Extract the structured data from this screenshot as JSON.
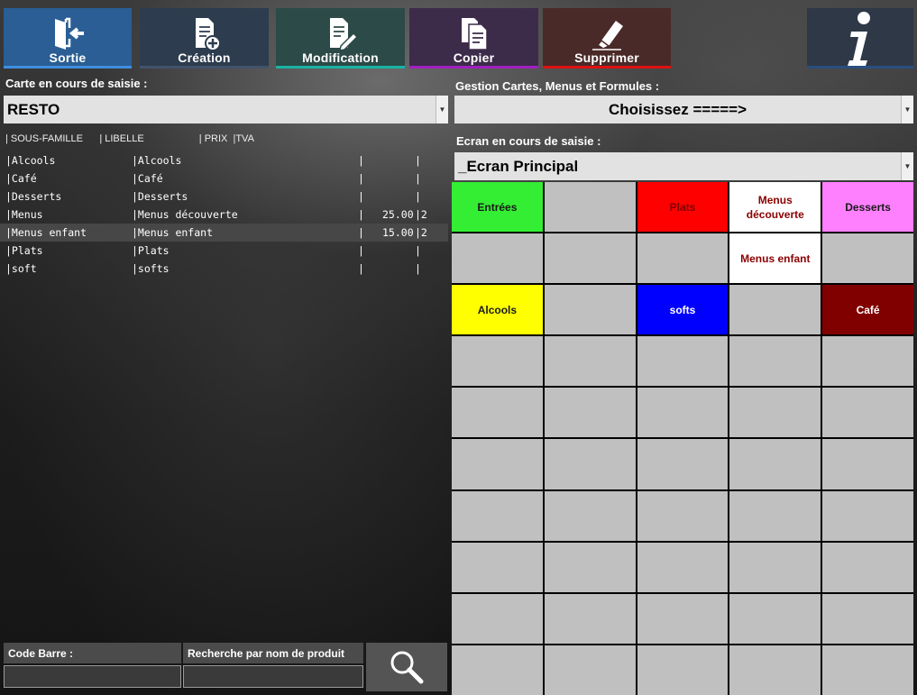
{
  "toolbar": {
    "sortie": "Sortie",
    "creation": "Création",
    "modification": "Modification",
    "copier": "Copier",
    "supprimer": "Supprimer"
  },
  "colors": {
    "sortie": "#2a5e94",
    "creation": "#2d3c4e",
    "modification": "#2c4a47",
    "copier": "#3d2b4a",
    "supprimer": "#4a2a28",
    "info": "#2f3846"
  },
  "left": {
    "carte_label": "Carte en cours de saisie :",
    "carte_value": "RESTO",
    "list_header": "| SOUS-FAMILLE      | LIBELLE                    | PRIX  |TVA",
    "rows": [
      {
        "sf": "|Alcools",
        "lib": "|Alcools",
        "sep": "|",
        "prix": "",
        "tva": "|"
      },
      {
        "sf": "|Café",
        "lib": "|Café",
        "sep": "|",
        "prix": "",
        "tva": "|"
      },
      {
        "sf": "|Desserts",
        "lib": "|Desserts",
        "sep": "|",
        "prix": "",
        "tva": "|"
      },
      {
        "sf": "|Menus",
        "lib": "|Menus découverte",
        "sep": "|",
        "prix": "25.00",
        "tva": "|2"
      },
      {
        "sf": "|Menus enfant",
        "lib": "|Menus enfant",
        "sep": "|",
        "prix": "15.00",
        "tva": "|2"
      },
      {
        "sf": "|Plats",
        "lib": "|Plats",
        "sep": "|",
        "prix": "",
        "tva": "|"
      },
      {
        "sf": "|soft",
        "lib": "|softs",
        "sep": "|",
        "prix": "",
        "tva": "|"
      }
    ],
    "selected_row_index": 4
  },
  "right": {
    "gestion_label": "Gestion Cartes, Menus et Formules  :",
    "gestion_value": "Choisissez  =====>",
    "ecran_label": "Ecran en cours de saisie :",
    "ecran_value": "_Ecran Principal"
  },
  "grid": {
    "buttons": [
      {
        "label": "Entrées",
        "bg": "#33ee33",
        "fg": "#1a1a1a"
      },
      {
        "label": "",
        "bg": "#c0c0c0",
        "fg": "#000"
      },
      {
        "label": "Plats",
        "bg": "#ff0000",
        "fg": "#7a0000"
      },
      {
        "label": "Menus\ndécouverte",
        "bg": "#ffffff",
        "fg": "#8b0000"
      },
      {
        "label": "Desserts",
        "bg": "#ff80ff",
        "fg": "#1a1a1a"
      },
      {
        "label": "",
        "bg": "#c0c0c0",
        "fg": "#000"
      },
      {
        "label": "",
        "bg": "#c0c0c0",
        "fg": "#000"
      },
      {
        "label": "",
        "bg": "#c0c0c0",
        "fg": "#000"
      },
      {
        "label": "Menus enfant",
        "bg": "#ffffff",
        "fg": "#8b0000"
      },
      {
        "label": "",
        "bg": "#c0c0c0",
        "fg": "#000"
      },
      {
        "label": "Alcools",
        "bg": "#ffff00",
        "fg": "#1a1a1a"
      },
      {
        "label": "",
        "bg": "#c0c0c0",
        "fg": "#000"
      },
      {
        "label": "softs",
        "bg": "#0000ff",
        "fg": "#ffffff"
      },
      {
        "label": "",
        "bg": "#c0c0c0",
        "fg": "#000"
      },
      {
        "label": "Café",
        "bg": "#800000",
        "fg": "#ffffff"
      }
    ]
  },
  "bottom": {
    "code_barre_label": "Code Barre :",
    "recherche_label": "Recherche par nom de produit"
  }
}
